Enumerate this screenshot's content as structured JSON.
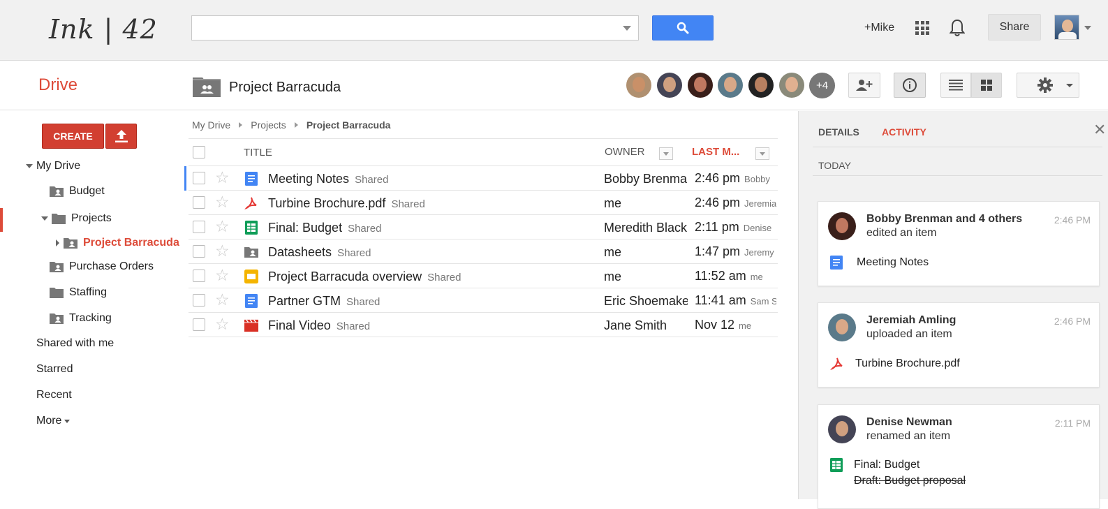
{
  "header": {
    "logo_text": "Ink | 42",
    "search": {
      "value": "",
      "placeholder": ""
    },
    "user_name": "+Mike",
    "share_label": "Share",
    "accent_color": "#4285f4"
  },
  "subheader": {
    "app_label": "Drive",
    "folder_title": "Project Barracuda",
    "more_members": "+4"
  },
  "nav": {
    "create_label": "CREATE",
    "items": [
      {
        "label": "My Drive"
      },
      {
        "label": "Budget"
      },
      {
        "label": "Projects"
      },
      {
        "label": "Project Barracuda"
      },
      {
        "label": "Purchase Orders"
      },
      {
        "label": "Staffing"
      },
      {
        "label": "Tracking"
      },
      {
        "label": "Shared with me"
      },
      {
        "label": "Starred"
      },
      {
        "label": "Recent"
      },
      {
        "label": "More"
      }
    ]
  },
  "breadcrumb": [
    "My Drive",
    "Projects",
    "Project Barracuda"
  ],
  "columns": {
    "title": "TITLE",
    "owner": "OWNER",
    "last_modified": "LAST M..."
  },
  "files": [
    {
      "name": "Meeting Notes",
      "type": "doc",
      "shared": "Shared",
      "owner": "Bobby Brenman",
      "time": "2:46 pm",
      "by": "Bobby"
    },
    {
      "name": "Turbine Brochure.pdf",
      "type": "pdf",
      "shared": "Shared",
      "owner": "me",
      "time": "2:46 pm",
      "by": "Jeremiah"
    },
    {
      "name": "Final: Budget",
      "type": "sheet",
      "shared": "Shared",
      "owner": "Meredith Black",
      "time": "2:11 pm",
      "by": "Denise"
    },
    {
      "name": "Datasheets",
      "type": "shared-folder",
      "shared": "Shared",
      "owner": "me",
      "time": "1:47 pm",
      "by": "Jeremy"
    },
    {
      "name": "Project Barracuda overview",
      "type": "slides",
      "shared": "Shared",
      "owner": "me",
      "time": "11:52 am",
      "by": "me"
    },
    {
      "name": "Partner GTM",
      "type": "doc",
      "shared": "Shared",
      "owner": "Eric Shoemaker",
      "time": "11:41 am",
      "by": "Sam S"
    },
    {
      "name": "Final Video",
      "type": "video",
      "shared": "Shared",
      "owner": "Jane Smith",
      "time": "Nov 12",
      "by": "me"
    }
  ],
  "panel": {
    "tab_details": "DETAILS",
    "tab_activity": "ACTIVITY",
    "today": "TODAY",
    "activities": [
      {
        "who": "Bobby Brenman and 4 others",
        "what": "edited an item",
        "time": "2:46 PM",
        "item": "Meeting Notes",
        "item_type": "doc"
      },
      {
        "who": "Jeremiah Amling",
        "what": "uploaded an item",
        "time": "2:46 PM",
        "item": "Turbine Brochure.pdf",
        "item_type": "pdf"
      },
      {
        "who": "Denise Newman",
        "what": "renamed an item",
        "time": "2:11 PM",
        "item": "Final: Budget",
        "item_type": "sheet",
        "old_name": "Draft: Budget proposal"
      }
    ]
  },
  "colors": {
    "brand_red": "#dd4b39",
    "docs_blue": "#4285f4",
    "sheets_green": "#0f9d58",
    "slides_yellow": "#f4b400"
  }
}
